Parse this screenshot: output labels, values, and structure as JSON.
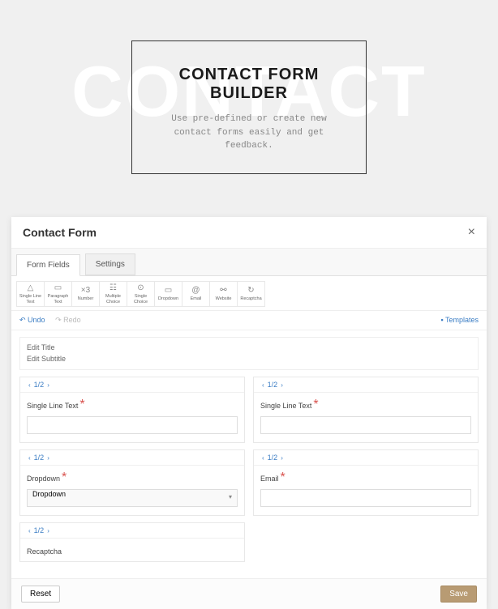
{
  "hero": {
    "bg_text": "CONTACT",
    "title": "CONTACT FORM BUILDER",
    "subtitle": "Use pre-defined or create new contact forms easily and get feedback."
  },
  "modal": {
    "title": "Contact Form",
    "close": "×"
  },
  "tabs": {
    "fields": "Form Fields",
    "settings": "Settings"
  },
  "tools": {
    "single_line": "Single Line Text",
    "paragraph": "Paragraph Text",
    "number": "Number",
    "multiple": "Multiple Choice",
    "single_choice": "Single Choice",
    "dropdown": "Dropdown",
    "email": "Email",
    "website": "Website",
    "recaptcha": "Recaptcha"
  },
  "tool_icons": {
    "single_line": "△",
    "paragraph": "▭",
    "number": "×3",
    "multiple": "☷",
    "single_choice": "⊙",
    "dropdown": "▭",
    "email": "@",
    "website": "⚯",
    "recaptcha": "↻"
  },
  "actions": {
    "undo": "↶ Undo",
    "redo": "↷ Redo",
    "templates": "▪ Templates"
  },
  "titles": {
    "edit_title": "Edit Title",
    "edit_subtitle": "Edit Subtitle"
  },
  "size": "1/2",
  "fields": {
    "f1": "Single Line Text",
    "f2": "Single Line Text",
    "f3": "Dropdown",
    "f4": "Email",
    "f5": "Recaptcha",
    "dropdown_value": "Dropdown"
  },
  "footer": {
    "reset": "Reset",
    "save": "Save"
  }
}
